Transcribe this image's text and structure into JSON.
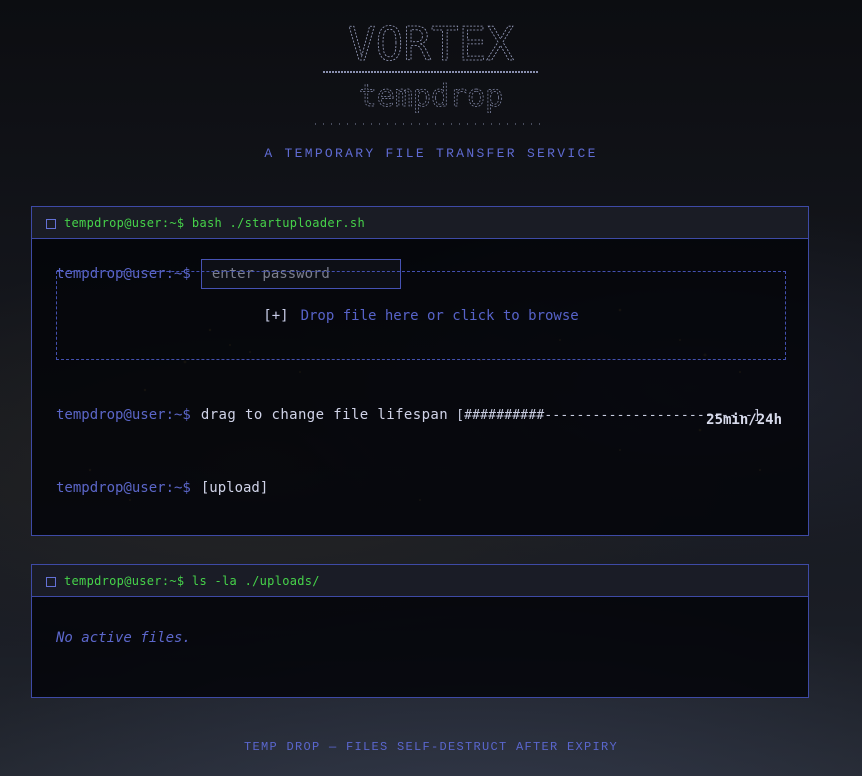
{
  "brand": {
    "logo_word": "VORTEX",
    "logo_sub": "tempdrop",
    "tagline": "A TEMPORARY FILE TRANSFER SERVICE"
  },
  "uploader": {
    "header_command": "tempdrop@user:~$ bash ./startuploader.sh",
    "prompt": "tempdrop@user:~$",
    "password_placeholder": "enter password",
    "password_value": "",
    "dropzone_plus": "[+]",
    "dropzone_text": "Drop file here or click to browse",
    "lifespan_label": "drag to change file lifespan",
    "lifespan_bar": "[##########--------------------------]",
    "lifespan_fraction": 0.28,
    "lifespan_value": "25min/24h",
    "upload_label": "[upload]"
  },
  "uploads": {
    "header_command": "tempdrop@user:~$ ls -la ./uploads/",
    "empty_message": "No active files."
  },
  "footer": {
    "text": "TEMP DROP — FILES SELF-DESTRUCT AFTER EXPIRY"
  },
  "colors": {
    "accent": "#4350b0",
    "prompt": "#5b66c8",
    "header_green": "#46d24a",
    "panel_border": "#3e4aa6"
  },
  "icons": {
    "panel_header_icon": "square-icon"
  }
}
